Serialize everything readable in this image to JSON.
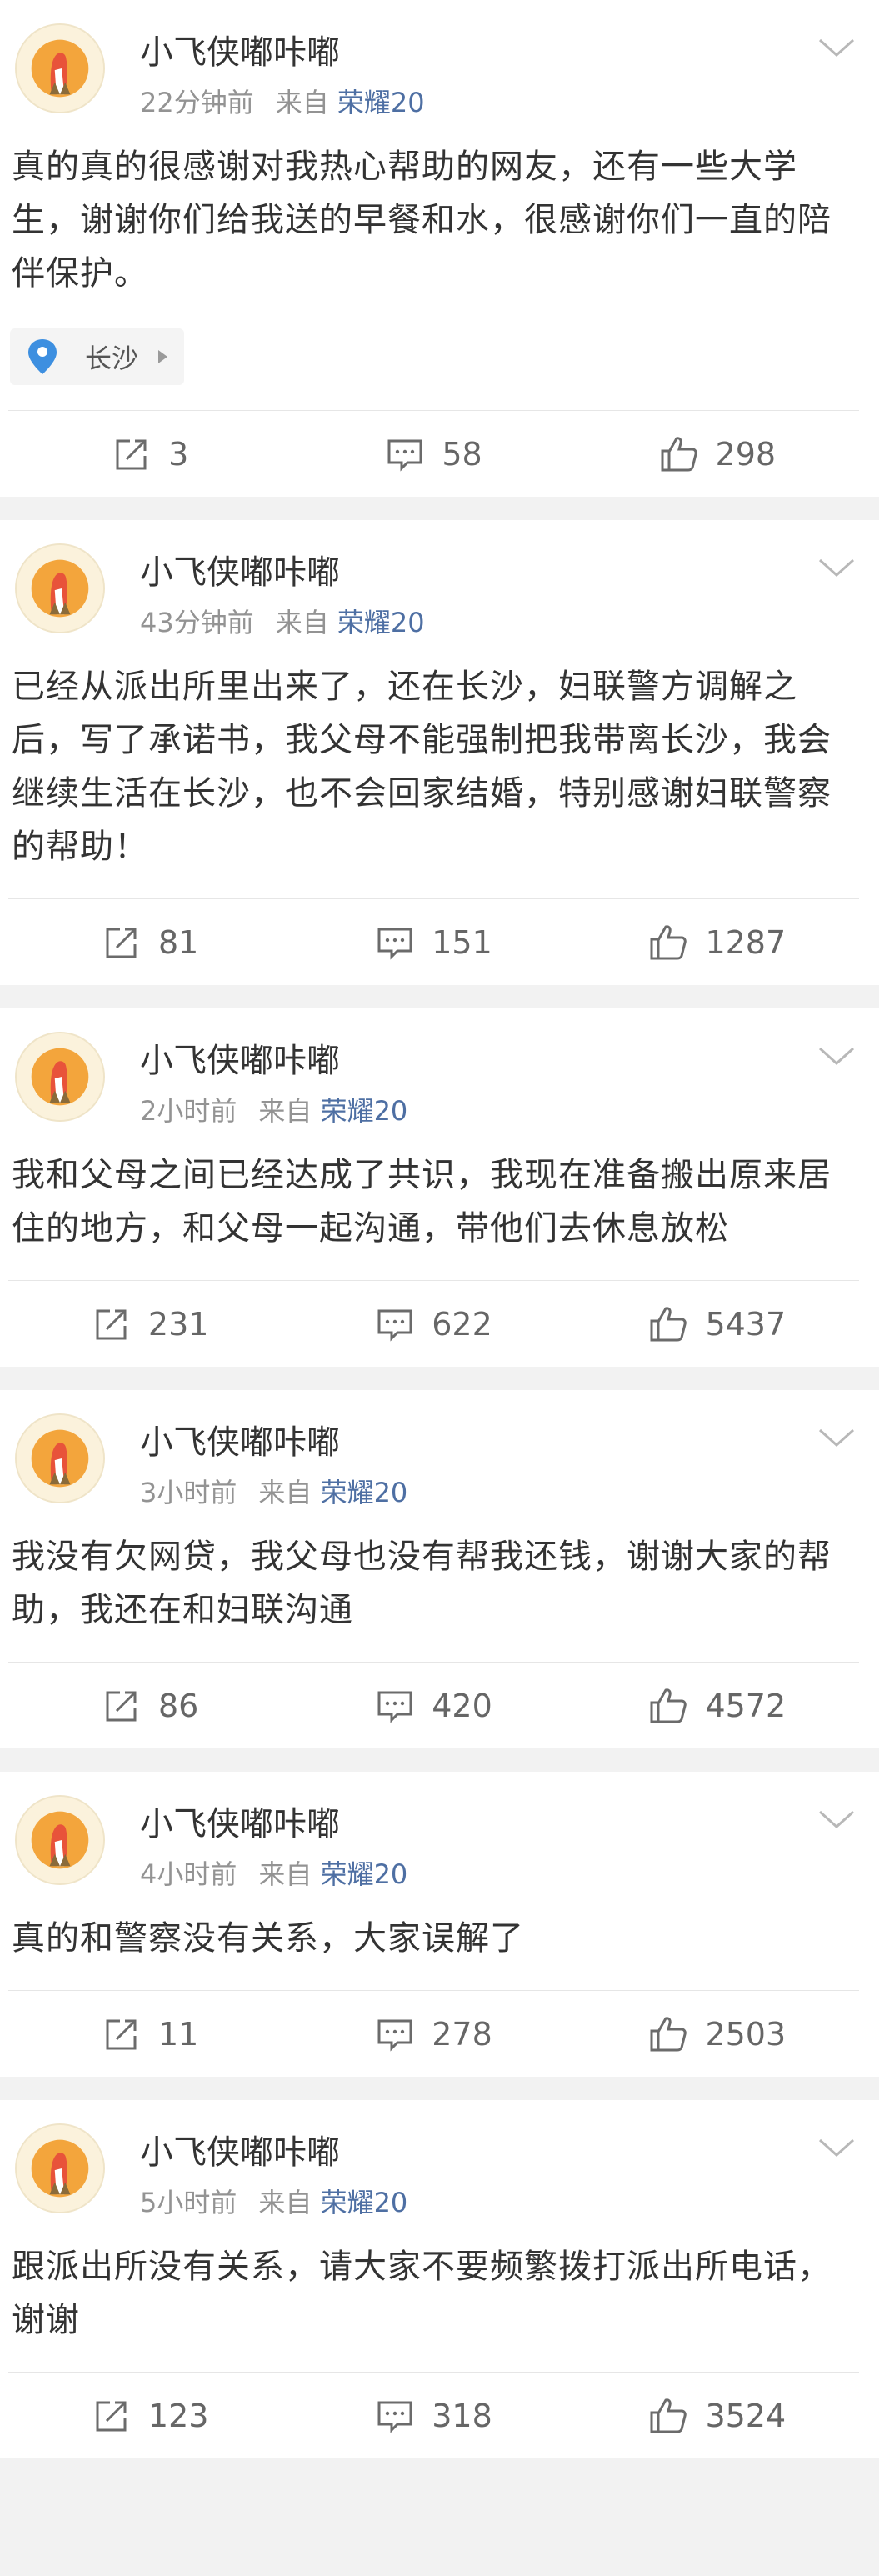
{
  "posts": [
    {
      "username": "小飞侠嘟咔嘟",
      "time": "22分钟前",
      "from_label": "来自",
      "source": "荣耀20",
      "text": "真的真的很感谢对我热心帮助的网友，还有一些大学生，谢谢你们给我送的早餐和水，很感谢你们一直的陪伴保护。",
      "location": "长沙",
      "reposts": "3",
      "comments": "58",
      "likes": "298"
    },
    {
      "username": "小飞侠嘟咔嘟",
      "time": "43分钟前",
      "from_label": "来自",
      "source": "荣耀20",
      "text": "已经从派出所里出来了，还在长沙，妇联警方调解之后，写了承诺书，我父母不能强制把我带离长沙，我会继续生活在长沙，也不会回家结婚，特别感谢妇联警察的帮助！",
      "reposts": "81",
      "comments": "151",
      "likes": "1287"
    },
    {
      "username": "小飞侠嘟咔嘟",
      "time": "2小时前",
      "from_label": "来自",
      "source": "荣耀20",
      "text": "我和父母之间已经达成了共识，我现在准备搬出原来居住的地方，和父母一起沟通，带他们去休息放松",
      "reposts": "231",
      "comments": "622",
      "likes": "5437"
    },
    {
      "username": "小飞侠嘟咔嘟",
      "time": "3小时前",
      "from_label": "来自",
      "source": "荣耀20",
      "text": "我没有欠网贷，我父母也没有帮我还钱，谢谢大家的帮助，我还在和妇联沟通",
      "reposts": "86",
      "comments": "420",
      "likes": "4572"
    },
    {
      "username": "小飞侠嘟咔嘟",
      "time": "4小时前",
      "from_label": "来自",
      "source": "荣耀20",
      "text": "真的和警察没有关系，大家误解了",
      "reposts": "11",
      "comments": "278",
      "likes": "2503"
    },
    {
      "username": "小飞侠嘟咔嘟",
      "time": "5小时前",
      "from_label": "来自",
      "source": "荣耀20",
      "text": "跟派出所没有关系，请大家不要频繁拨打派出所电话，谢谢",
      "reposts": "123",
      "comments": "318",
      "likes": "3524"
    }
  ],
  "icons": {
    "repost": "repost-icon",
    "comment": "comment-icon",
    "like": "thumbs-up-icon",
    "location": "location-pin-icon",
    "more": "chevron-down-icon"
  },
  "colors": {
    "source_link": "#4e6fa3",
    "meta": "#939393",
    "text": "#333333",
    "background": "#f2f2f2",
    "pin": "#3d8fe0"
  }
}
